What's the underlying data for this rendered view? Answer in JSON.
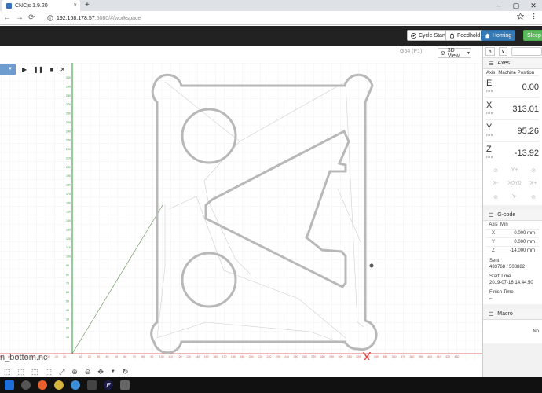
{
  "browser": {
    "tab_title": "CNCjs 1.9.20",
    "tab_close": "×",
    "new_tab": "+",
    "win_min": "–",
    "win_max": "▢",
    "win_close": "✕",
    "url_host": "192.168.178.57",
    "url_rest": ":5080/#/workspace",
    "back": "←",
    "forward": "→",
    "reload": "⟳"
  },
  "navbar": {
    "cycle_start": "Cycle Start",
    "feedhold": "Feedhold",
    "homing": "Homing",
    "sleep": "Sleep"
  },
  "toolbar": {
    "wcs": "G54 (P1)",
    "view": "3D View"
  },
  "visualizer": {
    "file_name": "n_bottom.nc",
    "y_ticks": [
      "300",
      "290",
      "280",
      "270",
      "260",
      "250",
      "240",
      "230",
      "220",
      "210",
      "200",
      "190",
      "180",
      "170",
      "160",
      "150",
      "140",
      "130",
      "120",
      "110",
      "100",
      "90",
      "80",
      "70",
      "60",
      "50",
      "40",
      "30",
      "20",
      "10"
    ],
    "x_ticks": [
      "10",
      "20",
      "30",
      "40",
      "50",
      "60",
      "70",
      "80",
      "90",
      "100",
      "110",
      "120",
      "130",
      "140",
      "150",
      "160",
      "170",
      "180",
      "190",
      "200",
      "210",
      "220",
      "230",
      "240",
      "250",
      "260",
      "270",
      "280",
      "290",
      "300",
      "310",
      "320",
      "330",
      "340",
      "350",
      "360",
      "370",
      "380",
      "390",
      "400",
      "410",
      "420",
      "430"
    ],
    "left_axis_ticks": [
      "90",
      "80",
      "70",
      "60",
      "50",
      "40",
      "30",
      "20",
      "10"
    ],
    "marker": "X"
  },
  "axes": {
    "title": "Axes",
    "col_axis": "Axis",
    "col_machine": "Machine Position",
    "rows": [
      {
        "axis": "E",
        "unit": "mm",
        "value": "0.00"
      },
      {
        "axis": "X",
        "unit": "mm",
        "value": "313.01"
      },
      {
        "axis": "Y",
        "unit": "mm",
        "value": "95.26"
      },
      {
        "axis": "Z",
        "unit": "mm",
        "value": "-13.92"
      }
    ],
    "jog": [
      "⊘",
      "Y+",
      "⊘",
      "X-",
      "X0Y0",
      "X+",
      "⊘",
      "Y-",
      "⊘"
    ]
  },
  "gcode": {
    "title": "G-code",
    "col_axis": "Axis",
    "col_min": "Min",
    "rows": [
      {
        "axis": "X",
        "min": "0.000 mm"
      },
      {
        "axis": "Y",
        "min": "0.000 mm"
      },
      {
        "axis": "Z",
        "min": "-14.000 mm"
      }
    ],
    "sent_label": "Sent",
    "sent_value": "433768 / 508882",
    "start_label": "Start Time",
    "start_value": "2019-07-16 14:44:50",
    "finish_label": "Finish Time",
    "finish_value": "–"
  },
  "macro": {
    "title": "Macro",
    "text": "No"
  }
}
